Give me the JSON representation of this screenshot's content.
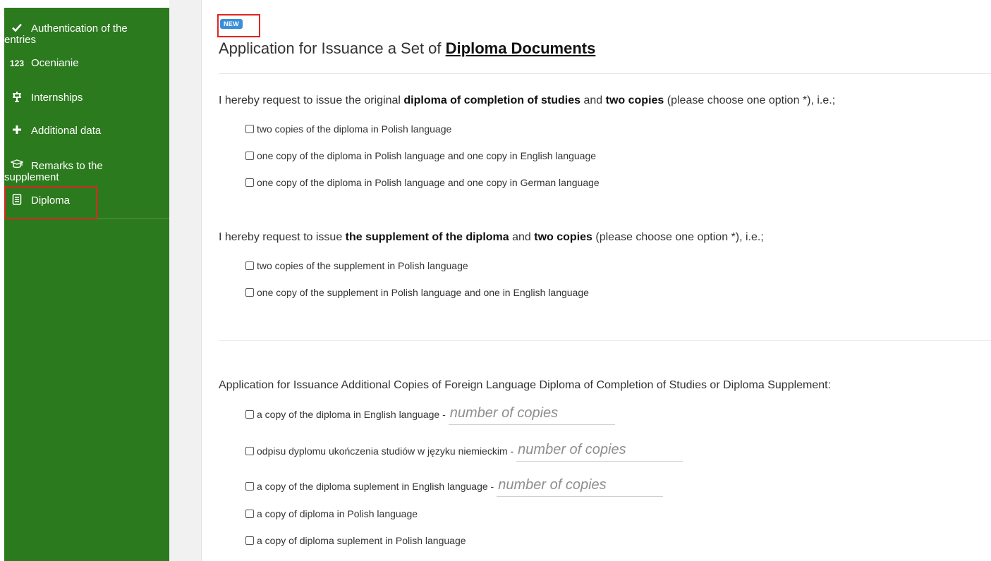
{
  "sidebar": {
    "items": [
      {
        "icon": "checkmark-icon",
        "line1": "Authentication of the",
        "line2": "entries"
      },
      {
        "icon": "123-icon",
        "label": "Ocenianie",
        "icon_text": "123"
      },
      {
        "icon": "internship-icon",
        "label": "Internships"
      },
      {
        "icon": "plus-icon",
        "label": "Additional data"
      },
      {
        "icon": "graduation-cap-icon",
        "line1": "Remarks to the",
        "line2": "supplement"
      },
      {
        "icon": "document-icon",
        "label": "Diploma"
      }
    ]
  },
  "header": {
    "badge": "NEW",
    "title_prefix": "Application for Issuance a Set of ",
    "title_link": "Diploma Documents"
  },
  "section1": {
    "q_part1": "I hereby request to issue the original ",
    "q_bold1": "diploma of completion of studies",
    "q_part2": " and ",
    "q_bold2": "two copies",
    "q_part3": " (please choose one option *), i.e.;",
    "options": [
      "two copies of the diploma in Polish language",
      "one copy of the diploma in Polish language and one copy in English language",
      "one copy of the diploma in Polish language and one copy in German language"
    ]
  },
  "section2": {
    "q_part1": "I hereby request to issue ",
    "q_bold1": "the supplement of the diploma",
    "q_part2": " and ",
    "q_bold2": "two copies",
    "q_part3": " (please choose one option *), i.e.;",
    "options": [
      "two copies of the supplement in Polish language",
      "one copy of the supplement in Polish language and one in English language"
    ]
  },
  "section3": {
    "heading": "Application for Issuance Additional Copies of Foreign Language Diploma of Completion of Studies or Diploma Supplement:",
    "options": [
      {
        "label": "a copy of the diploma in English language - ",
        "placeholder": "number of copies"
      },
      {
        "label": "odpisu dyplomu ukończenia studiów w języku niemieckim - ",
        "placeholder": "number of copies"
      },
      {
        "label": "a copy of the diploma suplement in English language - ",
        "placeholder": "number of copies"
      },
      {
        "label": "a copy of diploma in Polish language"
      },
      {
        "label": "a copy of diploma suplement in Polish language"
      }
    ]
  }
}
